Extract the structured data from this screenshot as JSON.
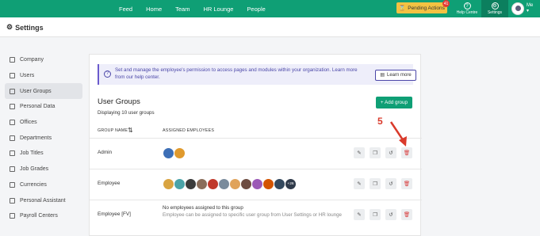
{
  "topnav": {
    "items": [
      "Feed",
      "Home",
      "Team",
      "HR Lounge",
      "People"
    ],
    "pending_label": "Pending Actions",
    "pending_count": "41",
    "help_label": "Help Centre",
    "settings_label": "Settings",
    "me_label": "Me"
  },
  "page_title": "Settings",
  "sidebar": {
    "items": [
      {
        "label": "Company",
        "icon": "building-icon"
      },
      {
        "label": "Users",
        "icon": "users-icon"
      },
      {
        "label": "User Groups",
        "icon": "user-groups-icon"
      },
      {
        "label": "Personal Data",
        "icon": "id-card-icon"
      },
      {
        "label": "Offices",
        "icon": "office-icon"
      },
      {
        "label": "Departments",
        "icon": "departments-icon"
      },
      {
        "label": "Job Titles",
        "icon": "briefcase-icon"
      },
      {
        "label": "Job Grades",
        "icon": "grades-icon"
      },
      {
        "label": "Currencies",
        "icon": "currency-icon"
      },
      {
        "label": "Personal Assistant",
        "icon": "assistant-icon"
      },
      {
        "label": "Payroll Centers",
        "icon": "payroll-icon"
      }
    ],
    "active_index": 2
  },
  "info": {
    "text": "Set and manage the employee's permission to access pages and modules within your organization. Learn more from our help center.",
    "learn_more": "Learn more"
  },
  "main": {
    "title": "User Groups",
    "subtitle": "Displaying 10 user groups",
    "add_button": "+ Add group",
    "col_group_name": "GROUP NAME",
    "col_assigned": "ASSIGNED EMPLOYEES",
    "rows": [
      {
        "name": "Admin",
        "avatars": [
          "#3d6fb6",
          "#e09a2d"
        ],
        "more": ""
      },
      {
        "name": "Employee",
        "avatars": [
          "#d9a441",
          "#4aa3a8",
          "#3b3b3b",
          "#8a6d5a",
          "#c0392b",
          "#7a8b9c",
          "#e0a35b",
          "#6d4c41",
          "#9b59b6",
          "#d35400",
          "#34495e"
        ],
        "more": "+26"
      },
      {
        "name": "Employee [FV]",
        "empty_title": "No employees assigned to this group",
        "empty_sub": "Employee can be assigned to specific user group from User Settings or HR lounge"
      }
    ]
  },
  "annotation": {
    "number": "5"
  },
  "colors": {
    "brand": "#0f9f75",
    "pending": "#f3c242",
    "info_accent": "#6a5acd",
    "annotation": "#d93a2b"
  }
}
